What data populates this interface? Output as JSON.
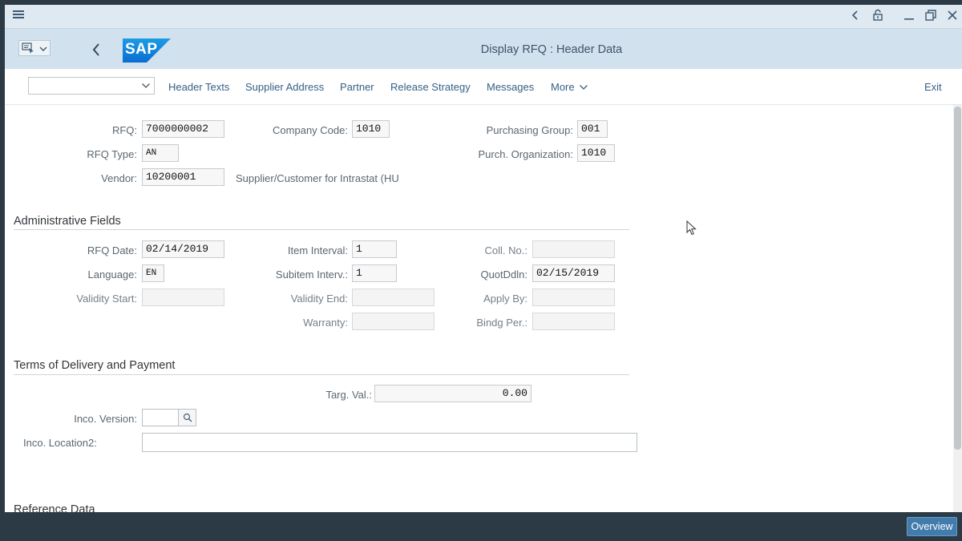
{
  "window": {
    "icons": [
      "menu-icon",
      "back-arrow-icon",
      "unlock-icon",
      "minimize-icon",
      "restore-icon",
      "close-icon"
    ]
  },
  "shell": {
    "title": "Display RFQ : Header Data",
    "logo_text": "SAP",
    "brand_color": "#0a6ed1"
  },
  "toolbar": {
    "dropdown_value": "",
    "links": {
      "header_texts": "Header Texts",
      "supplier_address": "Supplier Address",
      "partner": "Partner",
      "release_strategy": "Release Strategy",
      "messages": "Messages",
      "more": "More",
      "exit": "Exit"
    }
  },
  "header": {
    "rfq": {
      "label": "RFQ:",
      "value": "7000000002"
    },
    "rfq_type": {
      "label": "RFQ Type:",
      "value": "AN"
    },
    "vendor": {
      "label": "Vendor:",
      "value": "10200001",
      "description": "Supplier/Customer for Intrastat (HU"
    },
    "company_code": {
      "label": "Company Code:",
      "value": "1010"
    },
    "purchasing_group": {
      "label": "Purchasing Group:",
      "value": "001"
    },
    "purch_org": {
      "label": "Purch. Organization:",
      "value": "1010"
    }
  },
  "admin": {
    "title": "Administrative Fields",
    "rfq_date": {
      "label": "RFQ Date:",
      "value": "02/14/2019"
    },
    "language": {
      "label": "Language:",
      "value": "EN"
    },
    "validity_start": {
      "label": "Validity Start:",
      "value": ""
    },
    "item_interval": {
      "label": "Item Interval:",
      "value": "1"
    },
    "subitem_interval": {
      "label": "Subitem Interv.:",
      "value": "1"
    },
    "validity_end": {
      "label": "Validity End:",
      "value": ""
    },
    "warranty": {
      "label": "Warranty:",
      "value": ""
    },
    "coll_no": {
      "label": "Coll. No.:",
      "value": ""
    },
    "quot_deadline": {
      "label": "QuotDdln:",
      "value": "02/15/2019"
    },
    "apply_by": {
      "label": "Apply By:",
      "value": ""
    },
    "binding_period": {
      "label": "Bindg Per.:",
      "value": ""
    }
  },
  "terms": {
    "title": "Terms of Delivery and Payment",
    "target_value": {
      "label": "Targ. Val.:",
      "value": "0.00"
    },
    "inco_version": {
      "label": "Inco. Version:",
      "value": ""
    },
    "inco_location2": {
      "label": "Inco. Location2:",
      "value": ""
    }
  },
  "reference": {
    "title": "Reference Data"
  },
  "footer": {
    "overview_label": "Overview"
  }
}
